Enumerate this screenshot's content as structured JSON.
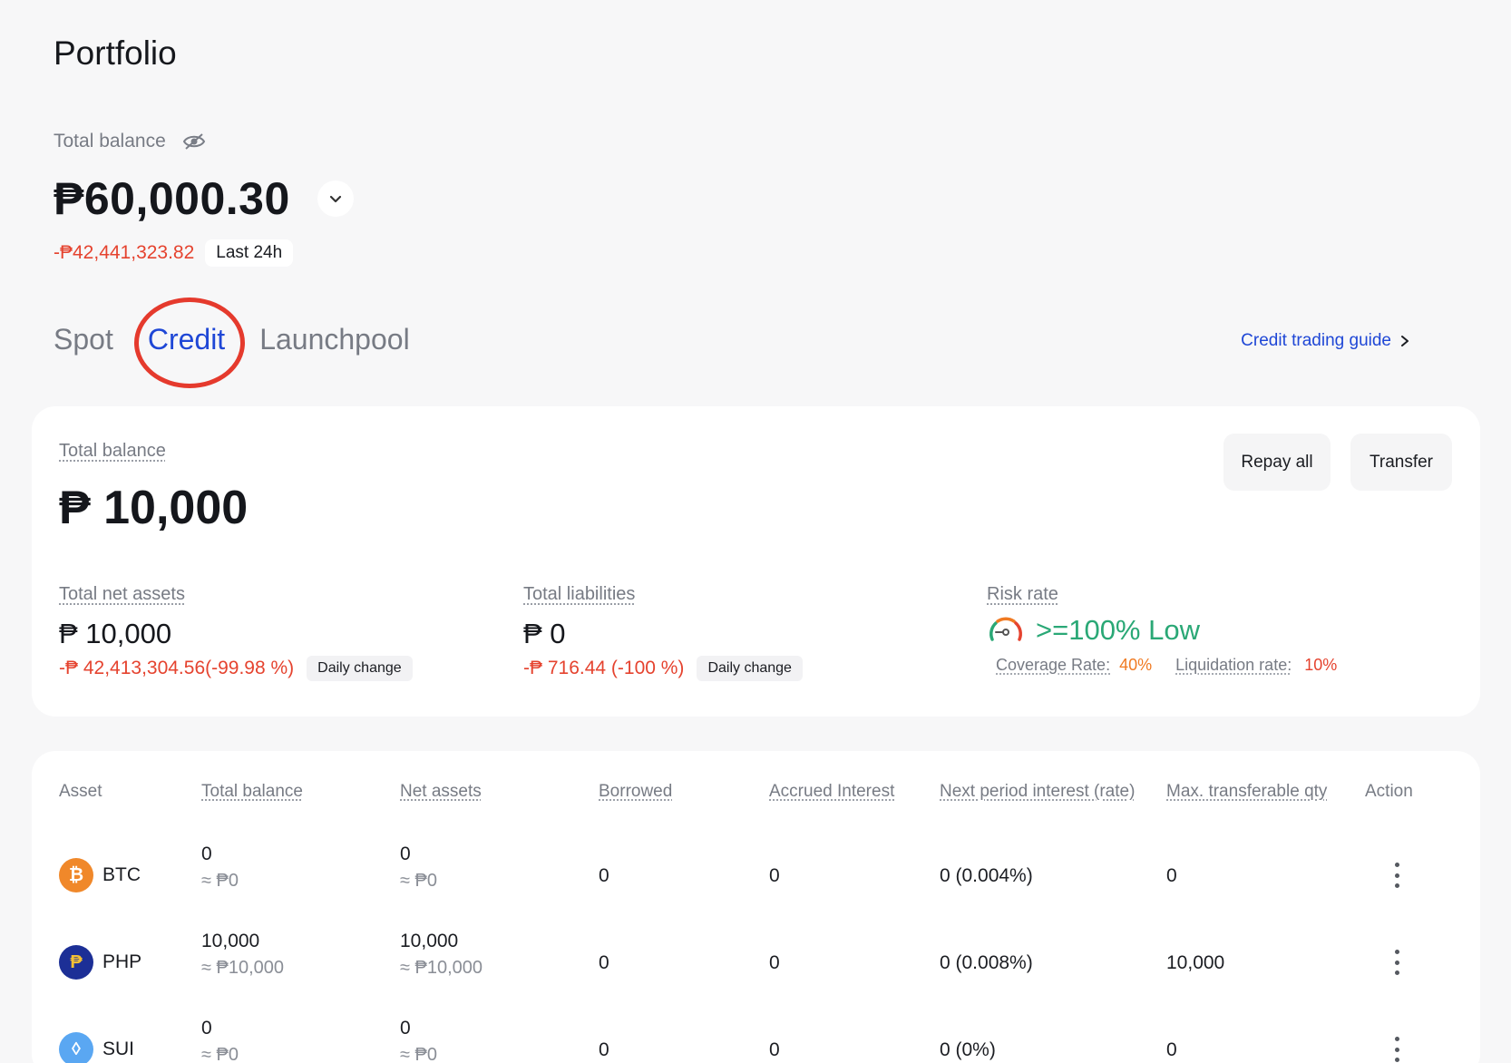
{
  "page": {
    "title": "Portfolio"
  },
  "balance": {
    "label": "Total balance",
    "amount": "₱60,000.30",
    "change": "-₱42,441,323.82",
    "period": "Last 24h"
  },
  "tabs": [
    {
      "label": "Spot",
      "active": false
    },
    {
      "label": "Credit",
      "active": true
    },
    {
      "label": "Launchpool",
      "active": false
    }
  ],
  "guide_link": "Credit trading guide",
  "summary": {
    "total_label": "Total balance",
    "total_amount": "₱ 10,000",
    "repay_label": "Repay all",
    "transfer_label": "Transfer",
    "net_assets": {
      "label": "Total net assets",
      "value": "₱ 10,000",
      "change": "-₱ 42,413,304.56(-99.98 %)",
      "badge": "Daily change"
    },
    "liabilities": {
      "label": "Total liabilities",
      "value": "₱ 0",
      "change": "-₱ 716.44 (-100 %)",
      "badge": "Daily change"
    },
    "risk": {
      "label": "Risk rate",
      "value": ">=100% Low",
      "coverage_label": "Coverage Rate:",
      "coverage_value": "40%",
      "liquidation_label": "Liquidation rate:",
      "liquidation_value": "10%"
    }
  },
  "table": {
    "headers": {
      "asset": "Asset",
      "total_balance": "Total balance",
      "net_assets": "Net assets",
      "borrowed": "Borrowed",
      "accrued": "Accrued Interest",
      "next_interest": "Next period interest (rate)",
      "max_transfer": "Max. transferable qty",
      "action": "Action"
    },
    "rows": [
      {
        "symbol": "BTC",
        "coin_glyph": "₿",
        "coin_color": "#f0882a",
        "total": "0",
        "total_fiat": "≈ ₱0",
        "net": "0",
        "net_fiat": "≈ ₱0",
        "borrowed": "0",
        "accrued": "0",
        "next": "0 (0.004%)",
        "max": "0"
      },
      {
        "symbol": "PHP",
        "coin_glyph": "₱",
        "coin_color": "#1c2f96",
        "total": "10,000",
        "total_fiat": "≈ ₱10,000",
        "net": "10,000",
        "net_fiat": "≈ ₱10,000",
        "borrowed": "0",
        "accrued": "0",
        "next": "0 (0.008%)",
        "max": "10,000"
      },
      {
        "symbol": "SUI",
        "coin_glyph": "◊",
        "coin_color": "#5aa7f2",
        "total": "0",
        "total_fiat": "≈ ₱0",
        "net": "0",
        "net_fiat": "≈ ₱0",
        "borrowed": "0",
        "accrued": "0",
        "next": "0 (0%)",
        "max": "0"
      }
    ]
  },
  "icons": {
    "hide_balance": "eye-slash-icon",
    "balance_menu": "chevron-down-icon",
    "guide_arrow": "chevron-right-icon",
    "risk": "gauge-icon",
    "row_action": "more-vertical-icon"
  },
  "colors": {
    "accent": "#1f47d6",
    "negative": "#e5432f",
    "positive": "#2aa876",
    "warning": "#f07a22",
    "highlight_circle": "#e53a2d"
  }
}
